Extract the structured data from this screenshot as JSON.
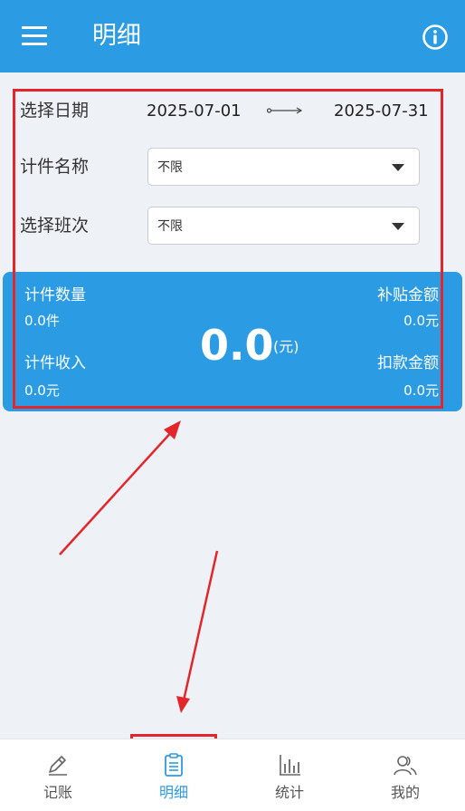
{
  "header": {
    "title": "明细",
    "menu_icon": "menu-icon",
    "info_icon": "info-icon"
  },
  "filters": {
    "date_label": "选择日期",
    "start_date": "2025-07-01",
    "end_date": "2025-07-31",
    "piece_label": "计件名称",
    "piece_value": "不限",
    "shift_label": "选择班次",
    "shift_value": "不限"
  },
  "summary": {
    "count_label": "计件数量",
    "count_value": "0.0件",
    "income_label": "计件收入",
    "income_value": "0.0元",
    "total": "0.0",
    "total_unit": "(元)",
    "subsidy_label": "补贴金额",
    "subsidy_value": "0.0元",
    "deduct_label": "扣款金额",
    "deduct_value": "0.0元"
  },
  "nav": {
    "items": [
      {
        "label": "记账",
        "icon": "pen-icon"
      },
      {
        "label": "明细",
        "icon": "clipboard-icon",
        "active": true
      },
      {
        "label": "统计",
        "icon": "bar-chart-icon"
      },
      {
        "label": "我的",
        "icon": "users-icon"
      }
    ]
  },
  "colors": {
    "primary": "#2b9be4",
    "annotation": "#e3262a",
    "background": "#eef2f7"
  }
}
